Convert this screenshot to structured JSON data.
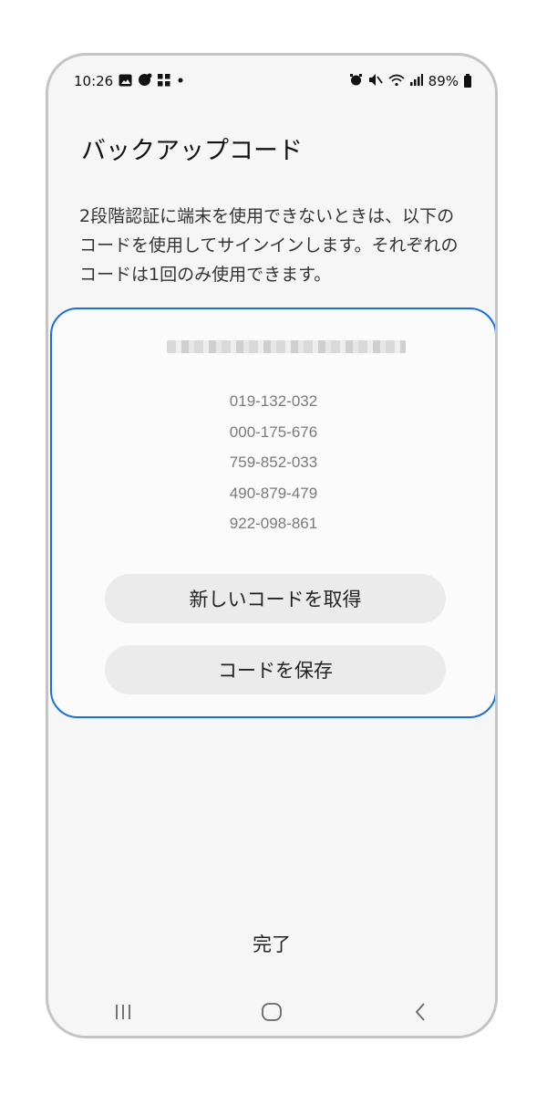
{
  "status_bar": {
    "time": "10:26",
    "battery": "89%",
    "left_icons": [
      "gallery-icon",
      "whatsapp-icon",
      "grid-icon",
      "dot-icon"
    ],
    "right_icons": [
      "alarm-icon",
      "mute-icon",
      "wifi-icon",
      "signal-icon",
      "battery-icon"
    ]
  },
  "page": {
    "title": "バックアップコード",
    "description": "2段階認証に端末を使用できないときは、以下のコードを使用してサインインします。それぞれのコードは1回のみ使用できます。"
  },
  "card": {
    "account_masked": "",
    "codes": [
      "019-132-032",
      "000-175-676",
      "759-852-033",
      "490-879-479",
      "922-098-861"
    ],
    "get_new_button": "新しいコードを取得",
    "save_button": "コードを保存"
  },
  "footer": {
    "done": "完了"
  },
  "nav": {
    "recents": "recents-icon",
    "home": "home-icon",
    "back": "back-icon"
  },
  "colors": {
    "accent": "#1a6fe0",
    "background": "#f6f6f6",
    "pill": "#ebebeb"
  }
}
